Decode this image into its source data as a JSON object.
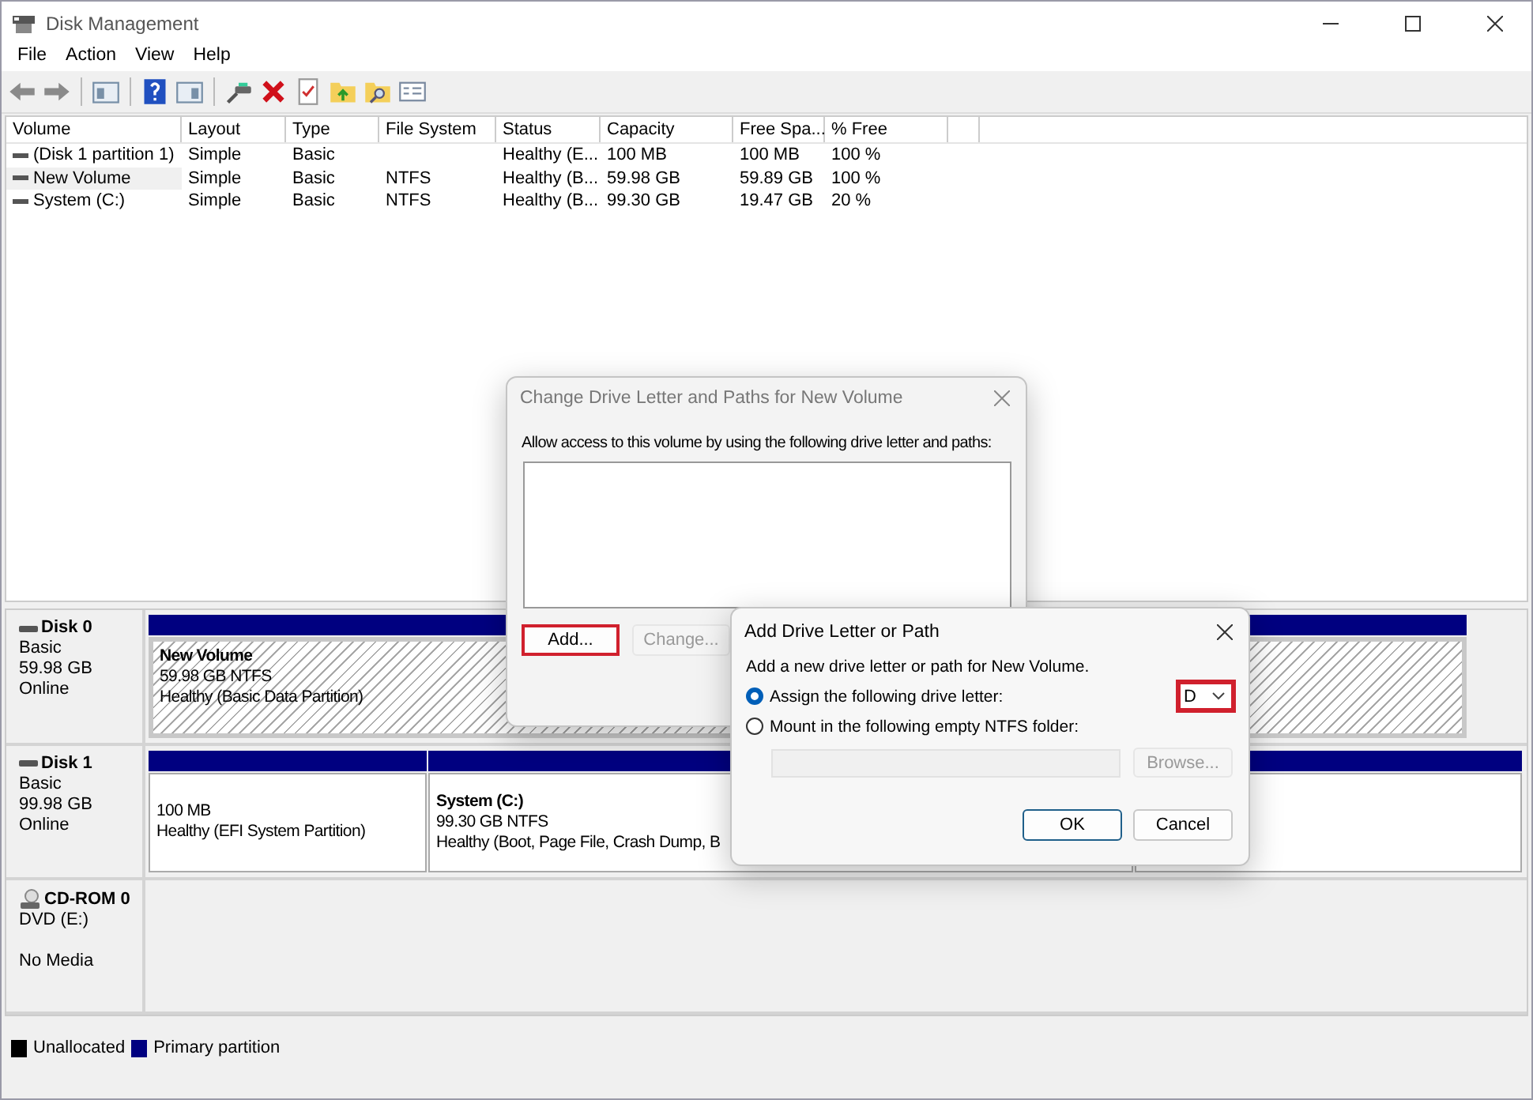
{
  "window": {
    "title": "Disk Management"
  },
  "menu": [
    "File",
    "Action",
    "View",
    "Help"
  ],
  "volume_table": {
    "columns": [
      "Volume",
      "Layout",
      "Type",
      "File System",
      "Status",
      "Capacity",
      "Free Spa...",
      "% Free"
    ],
    "rows": [
      {
        "selected": false,
        "cells": [
          "(Disk 1 partition 1)",
          "Simple",
          "Basic",
          "",
          "Healthy (E...",
          "100 MB",
          "100 MB",
          "100 %"
        ]
      },
      {
        "selected": true,
        "cells": [
          "New Volume",
          "Simple",
          "Basic",
          "NTFS",
          "Healthy (B...",
          "59.98 GB",
          "59.89 GB",
          "100 %"
        ]
      },
      {
        "selected": false,
        "cells": [
          "System (C:)",
          "Simple",
          "Basic",
          "NTFS",
          "Healthy (B...",
          "99.30 GB",
          "19.47 GB",
          "20 %"
        ]
      }
    ]
  },
  "disks": [
    {
      "kind": "disk",
      "name": "Disk 0",
      "lines": [
        "Basic",
        "59.98 GB",
        "Online"
      ],
      "partitions": [
        {
          "selected": true,
          "title": "New Volume",
          "lines": [
            "59.98 GB NTFS",
            "Healthy (Basic Data Partition)"
          ]
        }
      ]
    },
    {
      "kind": "disk",
      "name": "Disk 1",
      "lines": [
        "Basic",
        "99.98 GB",
        "Online"
      ],
      "partitions": [
        {
          "selected": false,
          "lines": [
            "100 MB",
            "Healthy (EFI System Partition)"
          ]
        },
        {
          "selected": false,
          "title": "System  (C:)",
          "lines": [
            "99.30 GB NTFS",
            "Healthy (Boot, Page File, Crash Dump, B"
          ]
        },
        {
          "selected": false
        }
      ]
    },
    {
      "kind": "cdrom",
      "name": "CD-ROM 0",
      "lines": [
        "DVD (E:)",
        "No Media"
      ]
    }
  ],
  "legend": [
    {
      "label": "Unallocated",
      "color": "#000000"
    },
    {
      "label": "Primary partition",
      "color": "#000080"
    }
  ],
  "change_dialog": {
    "title": "Change Drive Letter and Paths for New Volume",
    "description": "Allow access to this volume by using the following drive letter and paths:",
    "buttons": [
      {
        "label": "Add...",
        "disabled": false,
        "highlighted": true
      },
      {
        "label": "Change...",
        "disabled": true,
        "highlighted": false
      }
    ]
  },
  "add_dialog": {
    "title": "Add Drive Letter or Path",
    "description": "Add a new drive letter or path for New Volume.",
    "options": [
      {
        "label": "Assign the following drive letter:",
        "selected": true
      },
      {
        "label": "Mount in the following empty NTFS folder:",
        "selected": false
      }
    ],
    "drive_letter": {
      "value": "D",
      "highlighted": true
    },
    "folder_field": {
      "disabled": true
    },
    "browse_button": {
      "label": "Browse...",
      "disabled": true
    },
    "buttons": [
      {
        "label": "OK",
        "default": true
      },
      {
        "label": "Cancel",
        "default": false
      }
    ]
  }
}
